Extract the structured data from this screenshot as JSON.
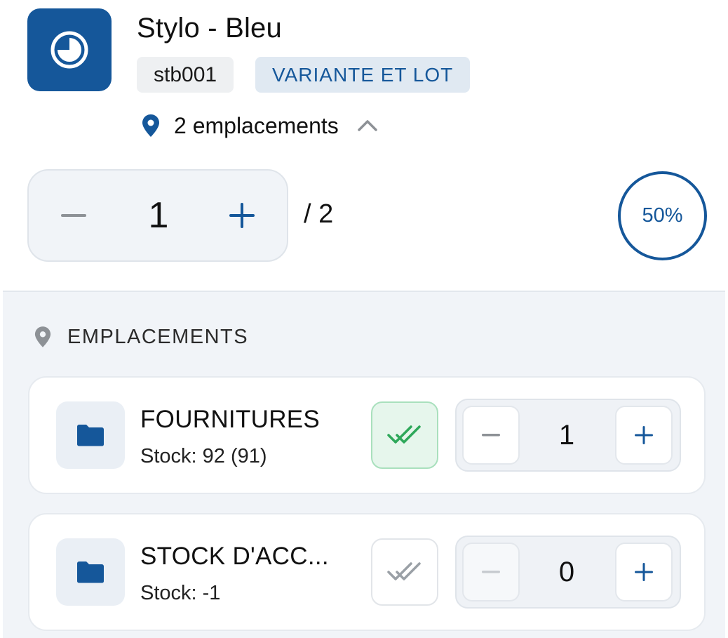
{
  "header": {
    "icon": "clock-icon",
    "title": "Stylo - Bleu",
    "sku": "stb001",
    "tag": "VARIANTE ET LOT",
    "locations_text": "2 emplacements",
    "locations_icon": "map-pin-icon",
    "toggle_icon": "chevron-up-icon"
  },
  "quantity": {
    "minus_icon": "minus-icon",
    "value": "1",
    "plus_icon": "plus-icon",
    "total": "/ 2"
  },
  "progress": {
    "label": "50%",
    "percent": 50
  },
  "locations_section": {
    "title": "EMPLACEMENTS",
    "icon": "map-pin-icon",
    "items": [
      {
        "name": "FOURNITURES",
        "stock": "Stock: 92 (91)",
        "validated": true,
        "qty": "1",
        "minus_enabled": true
      },
      {
        "name": "STOCK D'ACC...",
        "stock": "Stock: -1",
        "validated": false,
        "qty": "0",
        "minus_enabled": false
      }
    ]
  },
  "colors": {
    "brand": "#15579a",
    "check_on": "#2ea85a",
    "check_off": "#9aa0a6",
    "section_bg": "#f1f4f8"
  }
}
